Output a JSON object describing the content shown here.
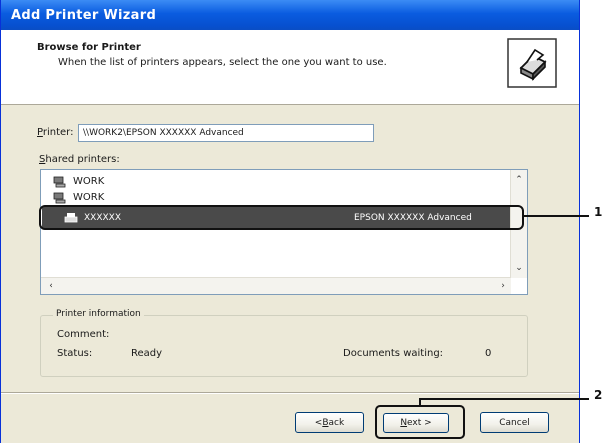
{
  "window": {
    "title": "Add Printer Wizard"
  },
  "header": {
    "title": "Browse for Printer",
    "subtitle": "When the list of printers appears, select the one you want to use.",
    "icon": "printer-icon"
  },
  "printer_field": {
    "label_prefix": "",
    "label_mnemonic": "P",
    "label_rest": "rinter:",
    "value": "\\\\WORK2\\EPSON XXXXXX Advanced"
  },
  "shared_printers": {
    "label_mnemonic": "S",
    "label_rest": "hared printers:",
    "items": [
      {
        "name": "WORK",
        "icon": "network-computer-icon"
      },
      {
        "name": "WORK",
        "icon": "network-computer-icon"
      }
    ],
    "selected": {
      "name": "XXXXXX",
      "description": "EPSON XXXXXX Advanced",
      "icon": "printer-icon"
    }
  },
  "printer_information": {
    "legend": "Printer information",
    "comment_label": "Comment:",
    "comment_value": "",
    "status_label": "Status:",
    "status_value": "Ready",
    "documents_waiting_label": "Documents waiting:",
    "documents_waiting_value": "0"
  },
  "buttons": {
    "back_pre": "< ",
    "back_mnemonic": "B",
    "back_rest": "ack",
    "next_mnemonic": "N",
    "next_rest": "ext >",
    "cancel": "Cancel"
  },
  "callouts": {
    "one": "1",
    "two": "2"
  },
  "colors": {
    "titlebar": "#0a5ce0",
    "selection": "#4a4a4a",
    "dialog_bg": "#ece9d8"
  }
}
